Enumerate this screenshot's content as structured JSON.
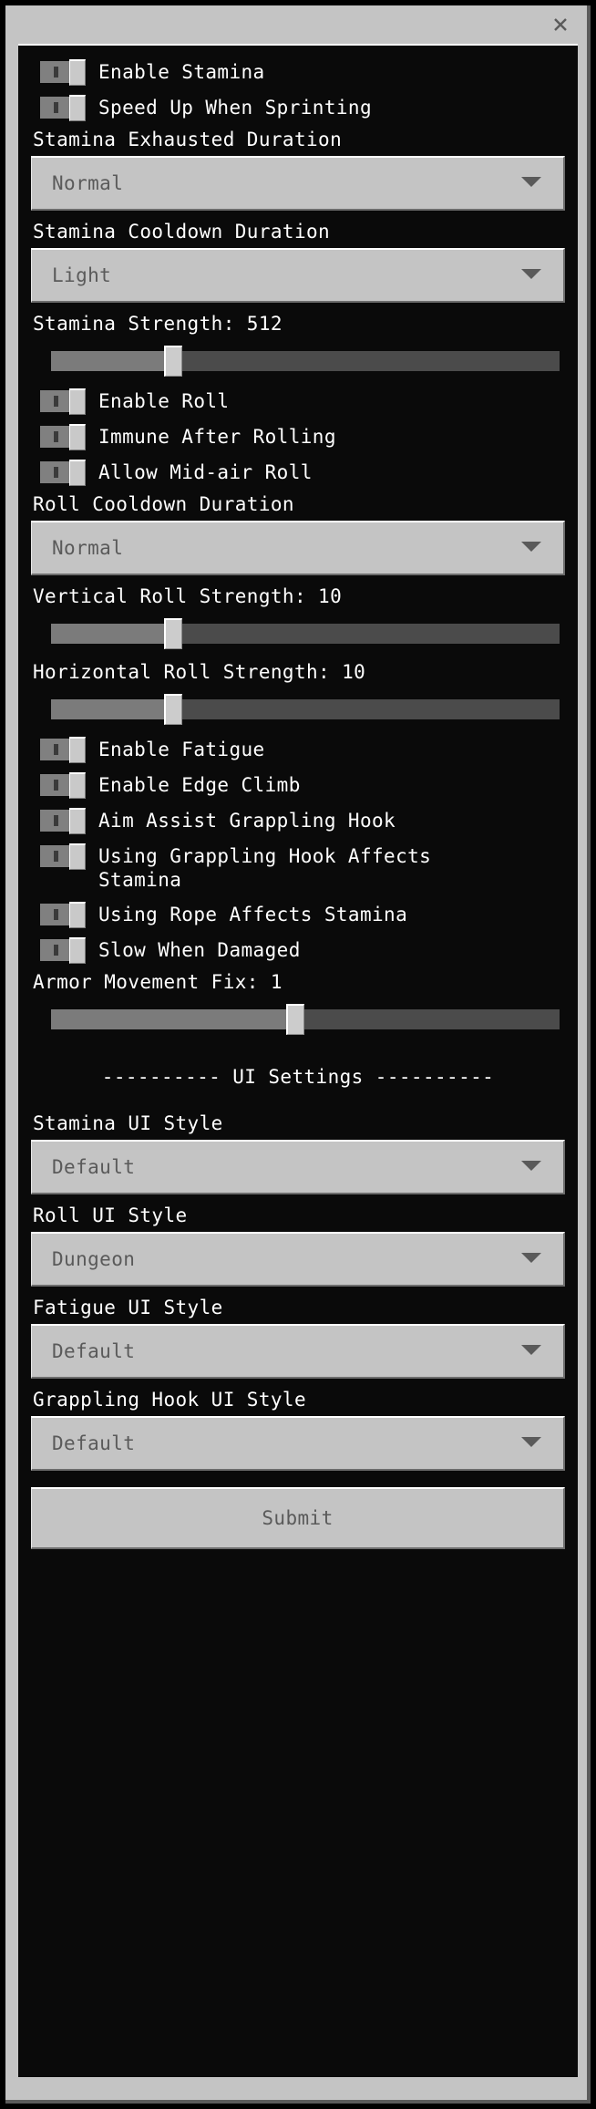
{
  "window": {
    "close_label": "×",
    "close_icon": "close-icon"
  },
  "controls": {
    "enable_stamina": {
      "label": "Enable Stamina",
      "type": "toggle",
      "value": "off"
    },
    "speed_up_sprinting": {
      "label": "Speed Up When Sprinting",
      "type": "toggle",
      "value": "off"
    },
    "stamina_exhausted_duration": {
      "label": "Stamina Exhausted Duration",
      "type": "dropdown",
      "value": "Normal"
    },
    "stamina_cooldown_duration": {
      "label": "Stamina Cooldown Duration",
      "type": "dropdown",
      "value": "Light"
    },
    "stamina_strength": {
      "label": "Stamina Strength: 512",
      "type": "slider",
      "value": 512,
      "percent": 24
    },
    "enable_roll": {
      "label": "Enable Roll",
      "type": "toggle",
      "value": "off"
    },
    "immune_after_rolling": {
      "label": "Immune After Rolling",
      "type": "toggle",
      "value": "off"
    },
    "allow_midair_roll": {
      "label": "Allow Mid-air Roll",
      "type": "toggle",
      "value": "off"
    },
    "roll_cooldown_duration": {
      "label": "Roll Cooldown Duration",
      "type": "dropdown",
      "value": "Normal"
    },
    "vertical_roll_strength": {
      "label": "Vertical Roll Strength: 10",
      "type": "slider",
      "value": 10,
      "percent": 24
    },
    "horizontal_roll_strength": {
      "label": "Horizontal Roll Strength: 10",
      "type": "slider",
      "value": 10,
      "percent": 24
    },
    "enable_fatigue": {
      "label": "Enable Fatigue",
      "type": "toggle",
      "value": "off"
    },
    "enable_edge_climb": {
      "label": "Enable Edge Climb",
      "type": "toggle",
      "value": "off"
    },
    "aim_assist_grappling_hook": {
      "label": "Aim Assist Grappling Hook",
      "type": "toggle",
      "value": "off"
    },
    "grappling_hook_affects_stamina": {
      "label": "Using Grappling Hook Affects Stamina",
      "type": "toggle",
      "value": "off"
    },
    "rope_affects_stamina": {
      "label": "Using Rope Affects Stamina",
      "type": "toggle",
      "value": "off"
    },
    "slow_when_damaged": {
      "label": "Slow When Damaged",
      "type": "toggle",
      "value": "off"
    },
    "armor_movement_fix": {
      "label": "Armor Movement Fix: 1",
      "type": "slider",
      "value": 1,
      "percent": 48
    },
    "ui_settings_divider": {
      "label": "---------- UI Settings ----------"
    },
    "stamina_ui_style": {
      "label": "Stamina UI Style",
      "type": "dropdown",
      "value": "Default"
    },
    "roll_ui_style": {
      "label": "Roll UI Style",
      "type": "dropdown",
      "value": "Dungeon"
    },
    "fatigue_ui_style": {
      "label": "Fatigue UI Style",
      "type": "dropdown",
      "value": "Default"
    },
    "grappling_hook_ui_style": {
      "label": "Grappling Hook UI Style",
      "type": "dropdown",
      "value": "Default"
    },
    "submit": {
      "label": "Submit"
    }
  },
  "colors": {
    "window_chrome": "#c4c4c4",
    "panel_bg": "#0a0a0a",
    "text_light": "#ffffff",
    "text_muted": "#5a5a5a",
    "slider_fill": "#7b7b7b",
    "slider_track": "#4b4b4b",
    "toggle_box": "#808080"
  }
}
